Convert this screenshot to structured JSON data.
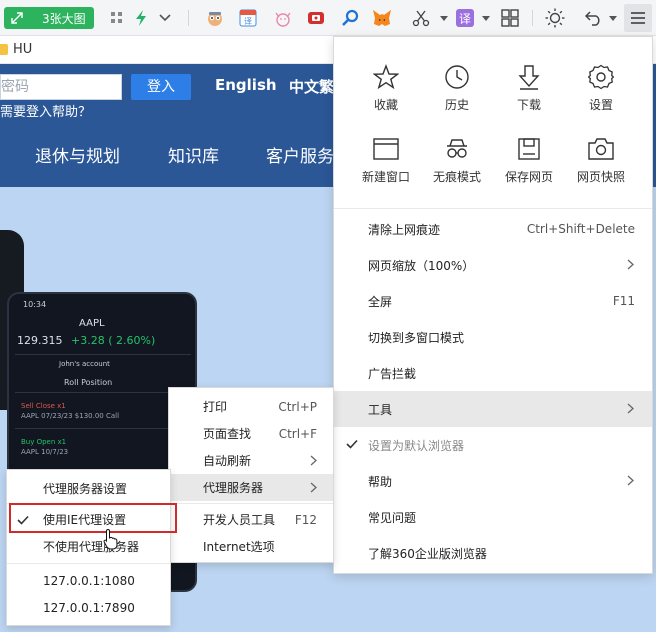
{
  "toolbar": {
    "screenshot_button_label": "3张大图",
    "icons": [
      "expand-arrows-icon",
      "grid-apps-icon",
      "lightning-icon",
      "chevron-down-icon",
      "avatar-cat-icon",
      "translate-ext-icon",
      "cat-face-icon",
      "video-icon",
      "search-icon",
      "metamask-fox-icon",
      "scissors-icon",
      "translate-icon",
      "apps-grid-icon",
      "brightness-icon",
      "undo-icon",
      "menu-icon"
    ],
    "translate_badge": "译"
  },
  "bookmarks": {
    "folder_label": "HU"
  },
  "website": {
    "password_placeholder": "密码",
    "login_button": "登入",
    "lang_english": "English",
    "lang_chinese": "中文繁",
    "help_link": "需要登入帮助？",
    "nav": [
      "退休与规划",
      "知识库",
      "客户服务"
    ],
    "phone": {
      "time": "10:34",
      "title": "AAPL",
      "price": "129.315",
      "change": "+3.28 ( 2.60%)",
      "account": "John's account",
      "section": "Roll Position",
      "sell_label": "Sell Close x1",
      "sell_detail": "AAPL 07/23/23 $130.00 Call",
      "buy_label": "Buy Open x1",
      "buy_detail": "AAPL 10/7/23"
    }
  },
  "main_menu": {
    "quick_actions": [
      {
        "label": "收藏",
        "icon": "star-icon"
      },
      {
        "label": "历史",
        "icon": "clock-icon"
      },
      {
        "label": "下载",
        "icon": "download-icon"
      },
      {
        "label": "设置",
        "icon": "gear-icon"
      },
      {
        "label": "新建窗口",
        "icon": "new-window-icon"
      },
      {
        "label": "无痕模式",
        "icon": "incognito-icon"
      },
      {
        "label": "保存网页",
        "icon": "save-icon"
      },
      {
        "label": "网页快照",
        "icon": "camera-icon"
      }
    ],
    "items": [
      {
        "label": "清除上网痕迹",
        "shortcut": "Ctrl+Shift+Delete"
      },
      {
        "label": "网页缩放（100%）",
        "submenu": true
      },
      {
        "label": "全屏",
        "shortcut": "F11"
      },
      {
        "label": "切换到多窗口模式"
      },
      {
        "label": "广告拦截"
      },
      {
        "label": "工具",
        "submenu": true,
        "highlighted": true
      },
      {
        "label": "设置为默认浏览器",
        "checked": true,
        "dim": true
      },
      {
        "label": "帮助",
        "submenu": true
      },
      {
        "label": "常见问题"
      },
      {
        "label": "了解360企业版浏览器"
      }
    ]
  },
  "tools_menu": {
    "items": [
      {
        "label": "打印",
        "shortcut": "Ctrl+P"
      },
      {
        "label": "页面查找",
        "shortcut": "Ctrl+F"
      },
      {
        "label": "自动刷新",
        "submenu": true
      },
      {
        "label": "代理服务器",
        "submenu": true,
        "highlighted": true
      },
      {
        "label": "开发人员工具",
        "shortcut": "F12"
      },
      {
        "label": "Internet选项"
      }
    ]
  },
  "proxy_menu": {
    "items": [
      {
        "label": "代理服务器设置"
      },
      {
        "label": "使用IE代理设置",
        "checked": true,
        "outlined": true
      },
      {
        "label": "不使用代理服务器"
      },
      {
        "label": "127.0.0.1:1080"
      },
      {
        "label": "127.0.0.1:7890"
      }
    ]
  },
  "colors": {
    "accent_green": "#2db35d",
    "site_blue": "#2b5797",
    "login_blue": "#2e7ee8",
    "outline_red": "#d12a2a",
    "hero_bg": "#bcd5f2"
  }
}
